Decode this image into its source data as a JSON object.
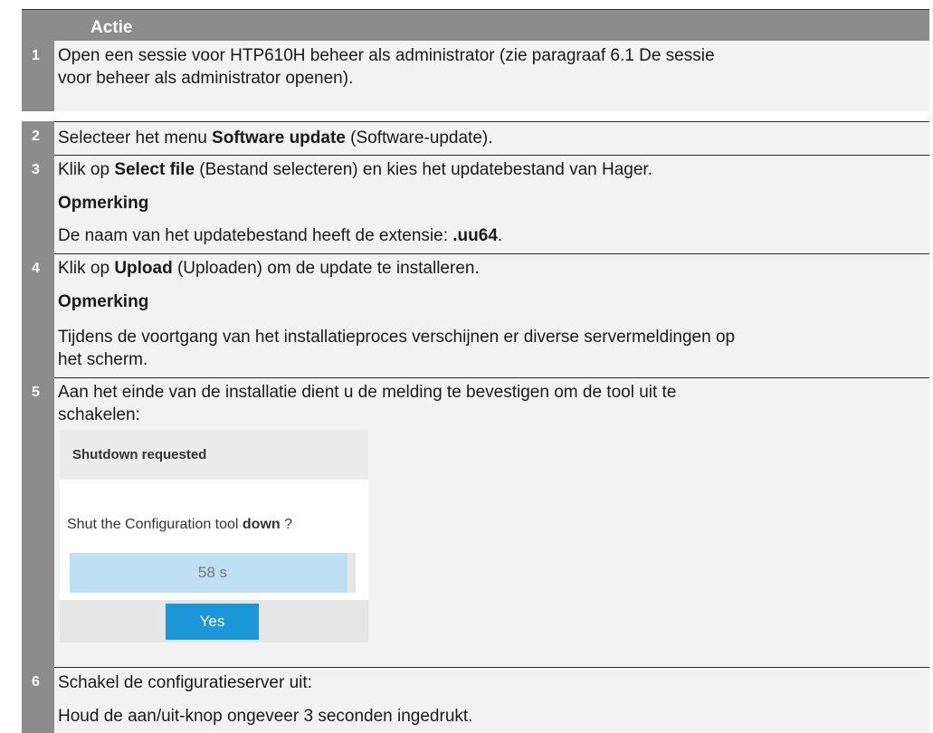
{
  "table": {
    "header": "Actie",
    "rows": [
      {
        "num": "1",
        "lines": [
          "Open een sessie voor HTP610H beheer als administrator (zie paragraaf 6.1 De sessie",
          "voor beheer als administrator openen)."
        ]
      },
      {
        "num": "2",
        "pre": "Selecteer het menu ",
        "bold": "Software update",
        "post": " (Software-update)."
      },
      {
        "num": "3",
        "pre": "Klik op ",
        "bold": "Select file",
        "post": " (Bestand selecteren) en kies het updatebestand van Hager.",
        "note_title": "Opmerking",
        "note_pre": "De naam van het updatebestand heeft de extensie: ",
        "note_bold": ".uu64",
        "note_post": "."
      },
      {
        "num": "4",
        "pre": "Klik op ",
        "bold": "Upload",
        "post": " (Uploaden) om de update te installeren.",
        "note_title": "Opmerking",
        "note_lines": [
          "Tijdens de voortgang van het installatieproces verschijnen er diverse servermeldingen op",
          "het scherm."
        ]
      },
      {
        "num": "5",
        "lines": [
          "Aan het einde van de installatie dient u de melding te bevestigen om de tool uit te",
          "schakelen:"
        ],
        "dialog": {
          "title": "Shutdown requested",
          "question_pre": "Shut the Configuration tool ",
          "question_bold": "down",
          "question_post": " ?",
          "countdown": "58 s",
          "progress_fraction": 0.97,
          "yes_label": "Yes"
        }
      },
      {
        "num": "6",
        "lines": [
          "Schakel de configuratieserver uit:",
          "Houd de aan/uit-knop ongeveer 3 seconden ingedrukt."
        ]
      }
    ]
  }
}
